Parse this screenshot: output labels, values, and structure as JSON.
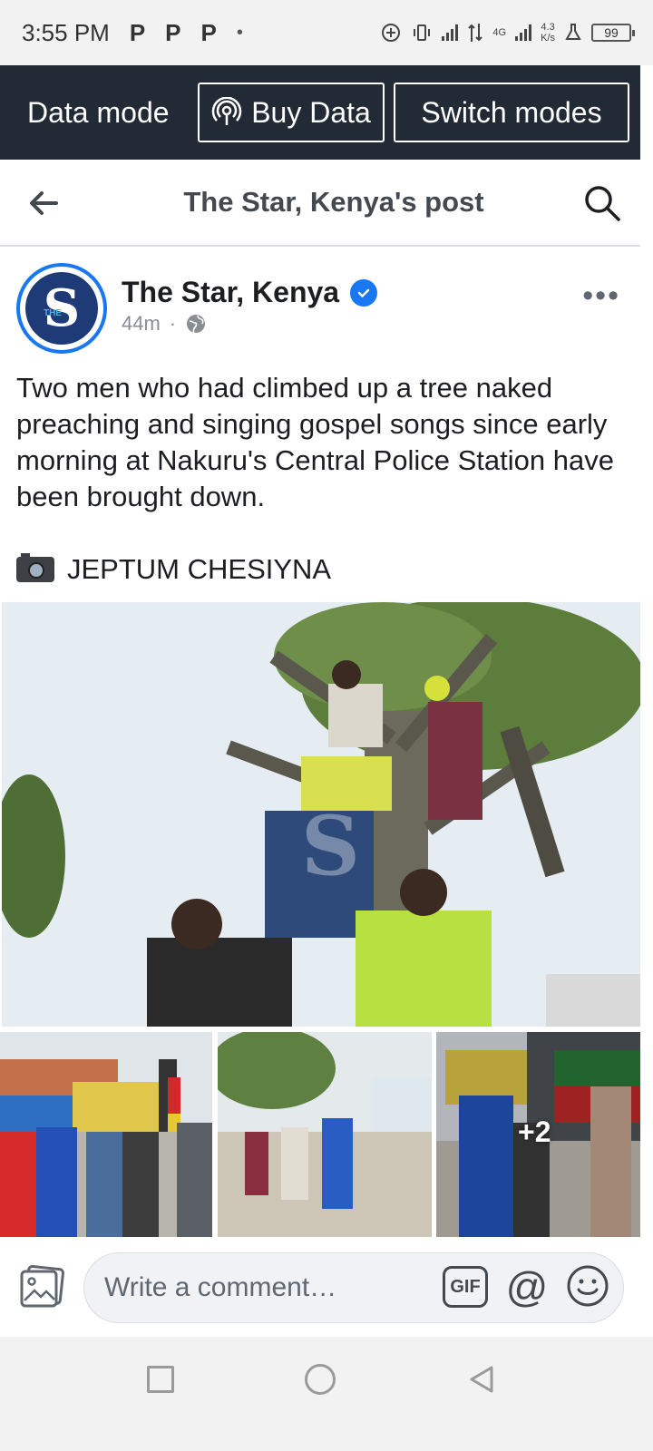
{
  "status_bar": {
    "time": "3:55 PM",
    "notification_icons": [
      "P",
      "P",
      "P"
    ],
    "dot": "•",
    "network_type": "4G",
    "speed_value": "4.3",
    "speed_unit": "K/s",
    "battery": "99"
  },
  "data_bar": {
    "mode_label": "Data mode",
    "buy_label": "Buy Data",
    "switch_label": "Switch modes",
    "background_color": "#222b35"
  },
  "header": {
    "title": "The Star, Kenya's post"
  },
  "post": {
    "page_name": "The Star, Kenya",
    "time_ago": "44m",
    "separator": "·",
    "avatar_letter": "S",
    "avatar_small_text": "THE",
    "text": "Two men who had climbed up a tree naked preaching and singing gospel songs since early morning  at Nakuru's Central Police Station have been brought down.",
    "photo_credit": "JEPTUM CHESIYNA",
    "more_photos_count": "+2"
  },
  "comment_bar": {
    "placeholder": "Write a comment…",
    "gif_label": "GIF",
    "mention_label": "@"
  },
  "colors": {
    "accent": "#1877f2",
    "text": "#1c1e21",
    "muted": "#8a8d91"
  }
}
